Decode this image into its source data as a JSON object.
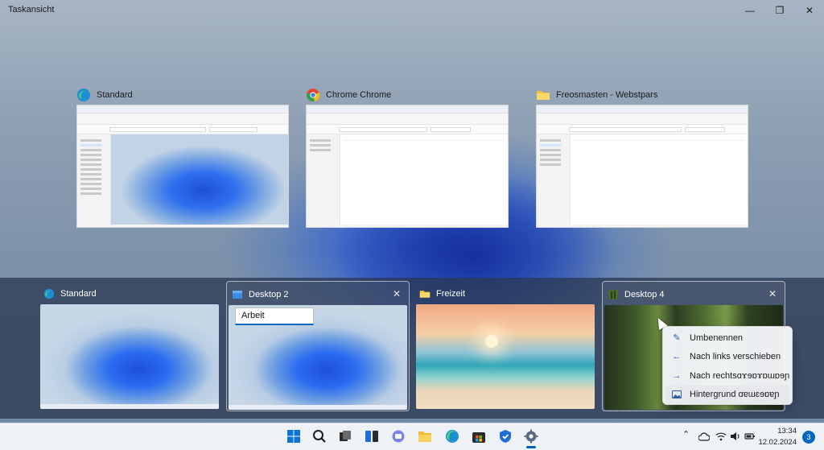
{
  "app": {
    "title": "Taskansicht"
  },
  "windows": [
    {
      "title": "Standard",
      "icon": "edge-icon",
      "thumb": "explorer-image"
    },
    {
      "title": "Chrome Chrome",
      "icon": "chrome-icon",
      "thumb": "explorer-blank"
    },
    {
      "title": "Freosmasten - Webstpars",
      "icon": "folder-icon",
      "thumb": "explorer-empty"
    }
  ],
  "desktops": [
    {
      "title": "Standard",
      "icon": "edge-icon",
      "wallpaper": "bloom"
    },
    {
      "title": "Desktop 2",
      "icon": "window-icon",
      "wallpaper": "bloom",
      "close": "✕"
    },
    {
      "title": "Freizeit",
      "icon": "folder-icon",
      "wallpaper": "beach"
    },
    {
      "title": "Desktop 4",
      "icon": "forest-icon",
      "wallpaper": "forest",
      "close": "✕"
    }
  ],
  "rename": {
    "value": "Arbeit"
  },
  "context_menu": {
    "items": [
      {
        "label": "Umbenennen",
        "icon": "pencil-icon"
      },
      {
        "label": "Nach links verschieben",
        "icon": "arrow-left-icon"
      },
      {
        "label": "Nach rechtsɑɤɘɒɤɒɯɒɘɲ",
        "icon": "arrow-right-icon"
      },
      {
        "label": "Hintergrund ɑɐɯɛɘɒɐɲ",
        "icon": "image-icon"
      }
    ]
  },
  "taskbar": {
    "apps": [
      "start-icon",
      "search-icon",
      "taskview-icon",
      "widgets-icon",
      "teams-icon",
      "file-explorer-icon",
      "edge-icon",
      "store-icon",
      "defender-icon",
      "settings-icon"
    ],
    "time": "13:34",
    "date": "12.02.2024",
    "notifications": "3"
  },
  "colors": {
    "accent": "#0067c0",
    "strip": "#2c3a54"
  }
}
